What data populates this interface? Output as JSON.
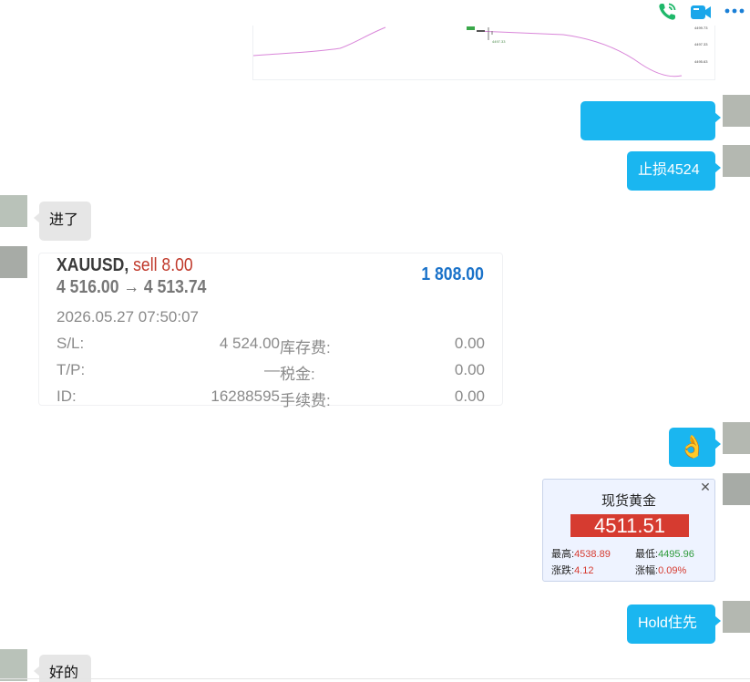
{
  "top_actions": {
    "voice_call_icon": "phone-icon",
    "video_call_icon": "video-icon",
    "more_icon": "more-icon"
  },
  "chart_snippet": {
    "ticks": [
      "4499.73",
      "4497.33",
      "4495.63"
    ],
    "marker_label": "4497.33"
  },
  "messages": {
    "m1_blank": "",
    "m2_text": "止损4524",
    "m3_text": "进了",
    "m4_emoji": "👌",
    "m5_text": "Hold住先",
    "m6_text": "好的"
  },
  "trade": {
    "symbol": "XAUUSD,",
    "side": "sell 8.00",
    "prices": "4 516.00 → 4 513.74",
    "profit": "1 808.00",
    "time": "2026.05.27 07:50:07",
    "rows": [
      {
        "label1": "S/L:",
        "value1": "4 524.00",
        "label2": "库存费:",
        "value2": "0.00"
      },
      {
        "label1": "T/P:",
        "value1": "—",
        "label2": "税金:",
        "value2": "0.00"
      },
      {
        "label1": "ID:",
        "value1": "16288595",
        "label2": "手续费:",
        "value2": "0.00"
      }
    ]
  },
  "quote": {
    "title": "现货黄金",
    "price": "4511.51",
    "high_label": "最高:",
    "high_value": "4538.89",
    "low_label": "最低:",
    "low_value": "4495.96",
    "change_label": "涨跌:",
    "change_value": "4.12",
    "pct_label": "涨幅:",
    "pct_value": "0.09%",
    "close_symbol": "✕"
  },
  "colors": {
    "my_bubble": "#1ab6f0",
    "their_bubble": "#e6e6e6",
    "sell_red": "#c0392b",
    "profit_blue": "#1a72c9",
    "quote_price_bg": "#d63b30",
    "low_green": "#2e9b3b"
  }
}
